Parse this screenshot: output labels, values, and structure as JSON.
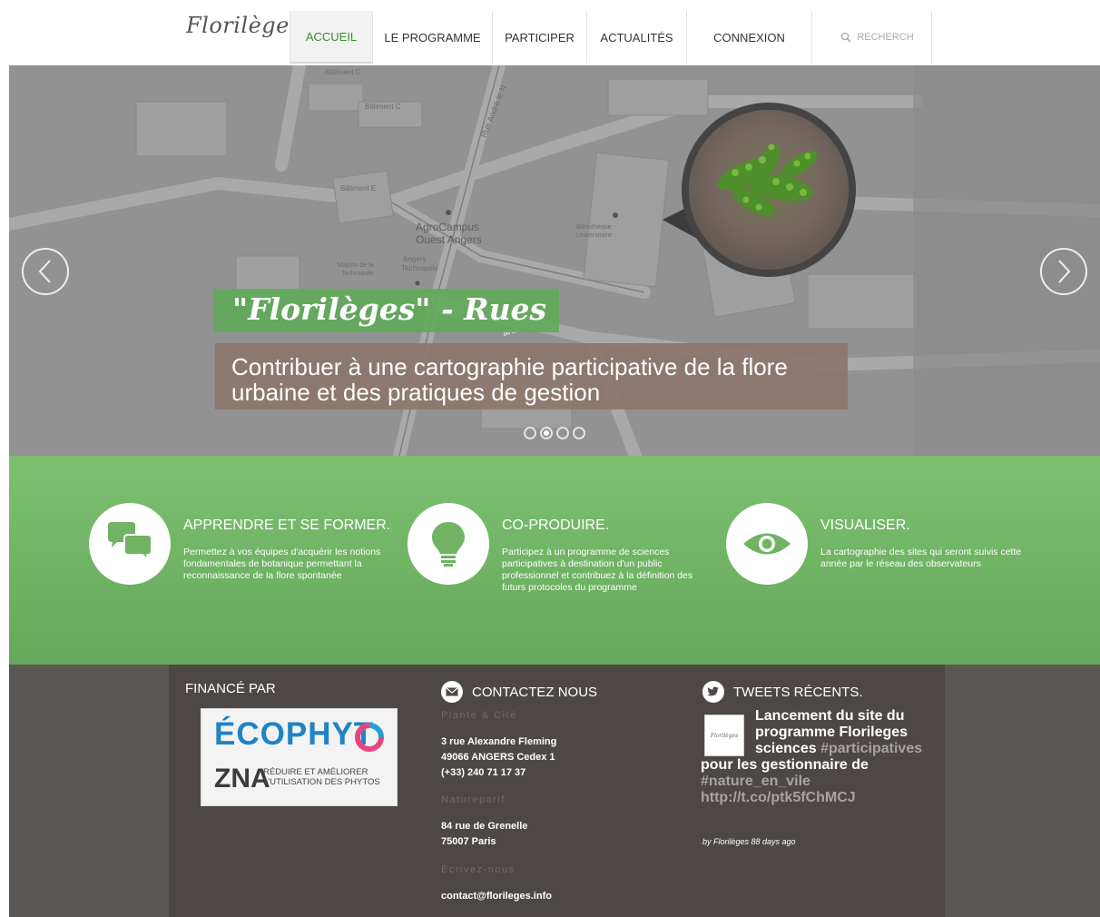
{
  "nav": {
    "logo": "Florilèges",
    "items": [
      {
        "label": "ACCUEIL",
        "active": true
      },
      {
        "label": "LE PROGRAMME",
        "active": false
      },
      {
        "label": "PARTICIPER",
        "active": false
      },
      {
        "label": "ACTUALITÉS",
        "active": false
      },
      {
        "label": "CONNEXION",
        "active": false
      }
    ],
    "search_placeholder": "RECHERCH",
    "search_icon": "search-icon"
  },
  "hero": {
    "title": "\"Florilèges\" - Rues",
    "subtitle_line1": "Contribuer à une cartographie participative de la flore",
    "subtitle_line2": "urbaine et des pratiques de gestion",
    "slide_count": 4,
    "active_slide": 2,
    "map_labels": {
      "batiment_c": "Bâtiment C",
      "batiment_e": "Bâtiment E",
      "rue": "Rue André le N",
      "agro1": "AgroCampus",
      "agro2": "Ouest Angers",
      "maison1": "Maison de la",
      "maison2": "Technopole",
      "angers1": "Angers",
      "angers2": "Technopole",
      "biblio1": "Bibliothèque",
      "biblio2": "Universitaire",
      "canal": "anal"
    },
    "prev_icon": "chevron-left-icon",
    "next_icon": "chevron-right-icon"
  },
  "features": [
    {
      "icon": "chat-bubbles-icon",
      "title": "APPRENDRE ET SE FORMER.",
      "desc": "Permettez à vos équipes d'acquérir les notions fondamentales de botanique permettant la reconnaissance de la flore spontanée"
    },
    {
      "icon": "lightbulb-icon",
      "title": "CO-PRODUIRE.",
      "desc": "Participez à un programme de sciences participatives à destination d'un public professionnel et contribuez à la définition des futurs protocoles du programme"
    },
    {
      "icon": "eye-icon",
      "title": "VISUALISER.",
      "desc": "La cartographie des sites qui seront suivis cette année par le réseau des observateurs"
    }
  ],
  "footer": {
    "funded_title": "FINANCÉ PAR",
    "sponsor": {
      "line1": "ÉCOPHYT",
      "line2": "ZNA",
      "tag1": "RÉDUIRE ET AMÉLIORER",
      "tag2": "L'UTILISATION DES PHYTOS"
    },
    "contact_title": "CONTACTEZ NOUS",
    "contact_icon": "envelope-icon",
    "org1": "Plante & Cité",
    "addr1_line1": "3 rue Alexandre Fleming",
    "addr1_line2": "49066 ANGERS Cedex 1",
    "addr1_line3": "(+33) 240 71 17 37",
    "org2": "Natureparif",
    "addr2_line1": "84 rue de Grenelle",
    "addr2_line2": "75007 Paris",
    "write_label": "Écrivez-nous",
    "email": "contact@florileges.info",
    "tweets_title": "TWEETS RÉCENTS.",
    "tweets_icon": "twitter-bird-icon",
    "tweet": {
      "avatar_text": "Florilèges",
      "part1": "Lancement du site du",
      "part2": "programme Florileges",
      "part3": "sciences",
      "hashtag1": "#participatives",
      "part4": "pour les gestionnaire de",
      "hashtag2": "#nature_en_vile",
      "link": "http://t.co/ptk5fChMCJ",
      "meta": "by Florilèges 88 days ago"
    }
  }
}
